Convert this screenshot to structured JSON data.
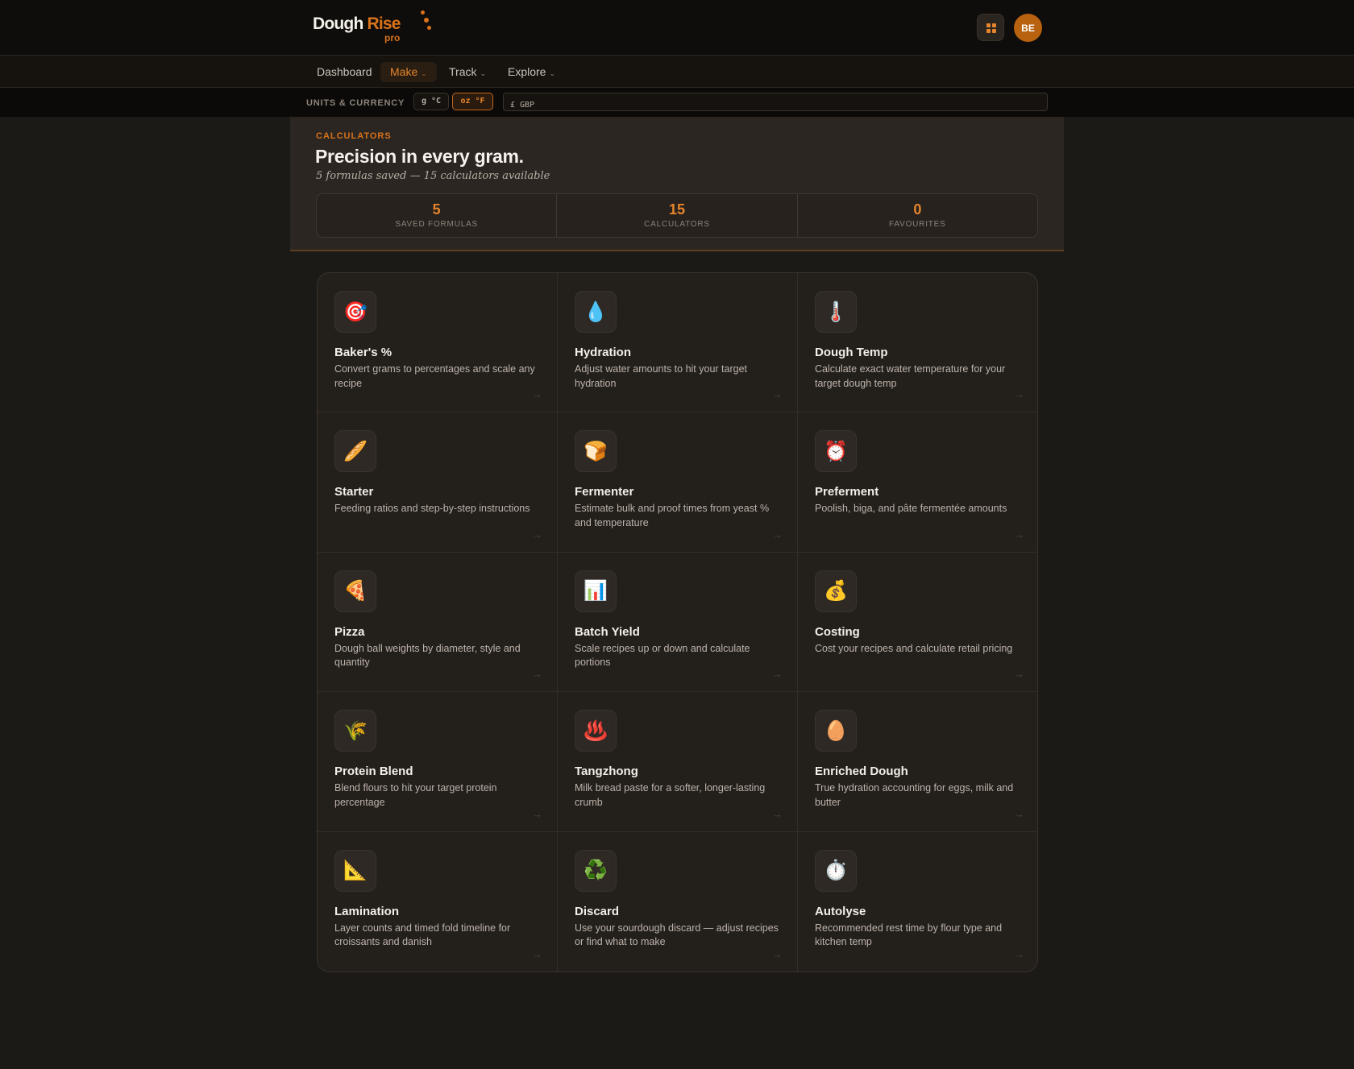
{
  "brand": {
    "name_a": "Dough",
    "name_b": "Rise",
    "tier": "pro"
  },
  "header": {
    "avatar_initials": "BE"
  },
  "nav": {
    "items": [
      {
        "label": "Dashboard",
        "caret": ""
      },
      {
        "label": "Make",
        "caret": "⌄"
      },
      {
        "label": "Track",
        "caret": "⌄"
      },
      {
        "label": "Explore",
        "caret": "⌄"
      }
    ]
  },
  "units": {
    "label": "UNITS & CURRENCY",
    "metric": "g °C",
    "imperial": "oz °F",
    "currency": "£ GBP"
  },
  "hero": {
    "eyebrow": "CALCULATORS",
    "title": "Precision in every gram.",
    "subtitle": "5 formulas saved — 15 calculators available",
    "stats": [
      {
        "value": "5",
        "label": "SAVED FORMULAS"
      },
      {
        "value": "15",
        "label": "CALCULATORS"
      },
      {
        "value": "0",
        "label": "FAVOURITES"
      }
    ]
  },
  "calculators": [
    {
      "icon": "🎯",
      "icon_name": "target-icon",
      "title": "Baker's %",
      "desc": "Convert grams to percentages and scale any recipe"
    },
    {
      "icon": "💧",
      "icon_name": "water-drop-icon",
      "title": "Hydration",
      "desc": "Adjust water amounts to hit your target hydration"
    },
    {
      "icon": "🌡️",
      "icon_name": "thermometer-icon",
      "title": "Dough Temp",
      "desc": "Calculate exact water temperature for your target dough temp"
    },
    {
      "icon": "🥖",
      "icon_name": "baguette-icon",
      "title": "Starter",
      "desc": "Feeding ratios and step-by-step instructions"
    },
    {
      "icon": "🍞",
      "icon_name": "bread-icon",
      "title": "Fermenter",
      "desc": "Estimate bulk and proof times from yeast % and temperature"
    },
    {
      "icon": "⏰",
      "icon_name": "alarm-clock-icon",
      "title": "Preferment",
      "desc": "Poolish, biga, and pâte fermentée amounts"
    },
    {
      "icon": "🍕",
      "icon_name": "pizza-icon",
      "title": "Pizza",
      "desc": "Dough ball weights by diameter, style and quantity"
    },
    {
      "icon": "📊",
      "icon_name": "bar-chart-icon",
      "title": "Batch Yield",
      "desc": "Scale recipes up or down and calculate portions"
    },
    {
      "icon": "💰",
      "icon_name": "money-bag-icon",
      "title": "Costing",
      "desc": "Cost your recipes and calculate retail pricing"
    },
    {
      "icon": "🌾",
      "icon_name": "wheat-icon",
      "title": "Protein Blend",
      "desc": "Blend flours to hit your target protein percentage"
    },
    {
      "icon": "♨️",
      "icon_name": "hot-springs-icon",
      "title": "Tangzhong",
      "desc": "Milk bread paste for a softer, longer-lasting crumb"
    },
    {
      "icon": "🥚",
      "icon_name": "egg-icon",
      "title": "Enriched Dough",
      "desc": "True hydration accounting for eggs, milk and butter"
    },
    {
      "icon": "📐",
      "icon_name": "triangle-ruler-icon",
      "title": "Lamination",
      "desc": "Layer counts and timed fold timeline for croissants and danish"
    },
    {
      "icon": "♻️",
      "icon_name": "recycle-icon",
      "title": "Discard",
      "desc": "Use your sourdough discard — adjust recipes or find what to make"
    },
    {
      "icon": "⏱️",
      "icon_name": "stopwatch-icon",
      "title": "Autolyse",
      "desc": "Recommended rest time by flour type and kitchen temp"
    }
  ],
  "card_arrow": "→",
  "colors": {
    "accent": "#d9731b",
    "background": "#1c1a17",
    "panel": "#2b2621"
  }
}
